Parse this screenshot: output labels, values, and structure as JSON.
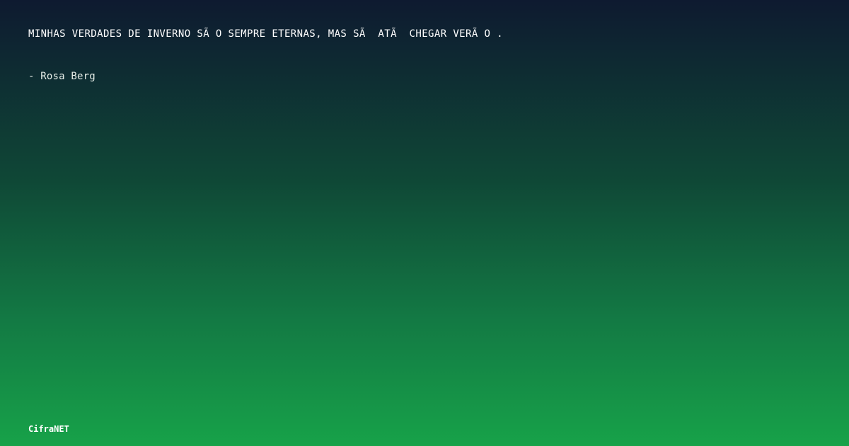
{
  "quote": {
    "text": "MINHAS VERDADES DE INVERNO SÃ O SEMPRE ETERNAS, MAS SÃ  ATÃ  CHEGAR VERÃ O ."
  },
  "author": {
    "text": "- Rosa Berg"
  },
  "brand": {
    "name": "CifraNET"
  },
  "colors": {
    "gradient_top": "#0e1a30",
    "gradient_mid": "#0f4736",
    "gradient_bottom": "#17a249",
    "text": "#ffffff"
  }
}
